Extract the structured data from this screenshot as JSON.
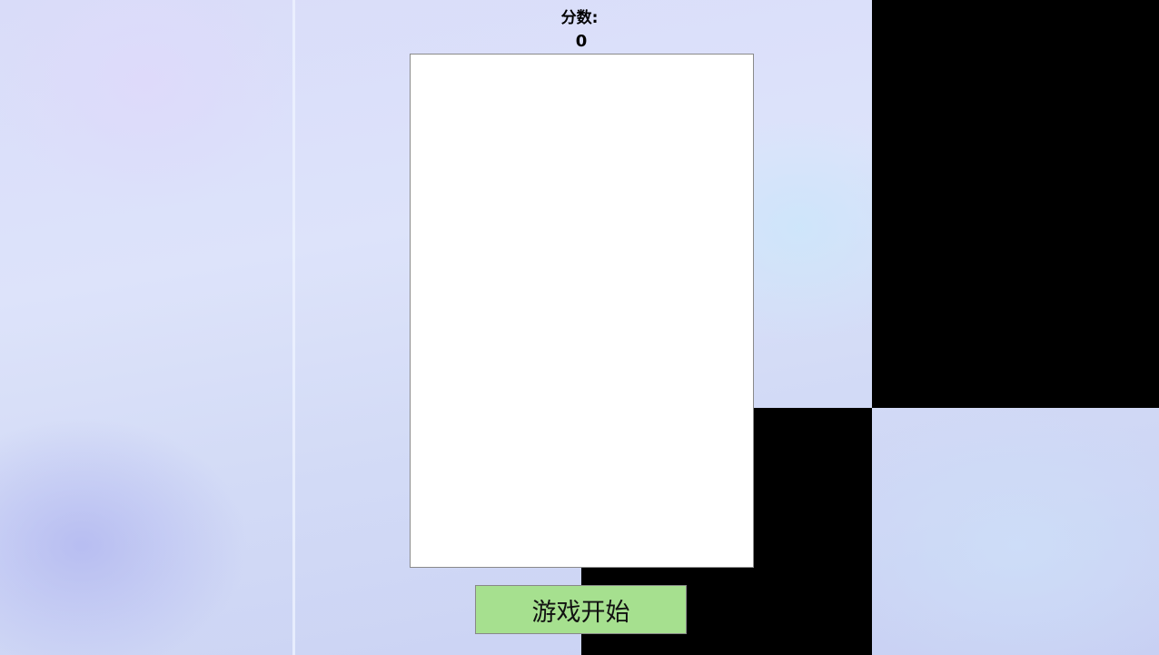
{
  "score": {
    "label": "分数:",
    "value": "0"
  },
  "controls": {
    "start_label": "游戏开始"
  },
  "colors": {
    "button_bg": "#a6e08f",
    "tile": "#000000",
    "board": "#ffffff"
  }
}
